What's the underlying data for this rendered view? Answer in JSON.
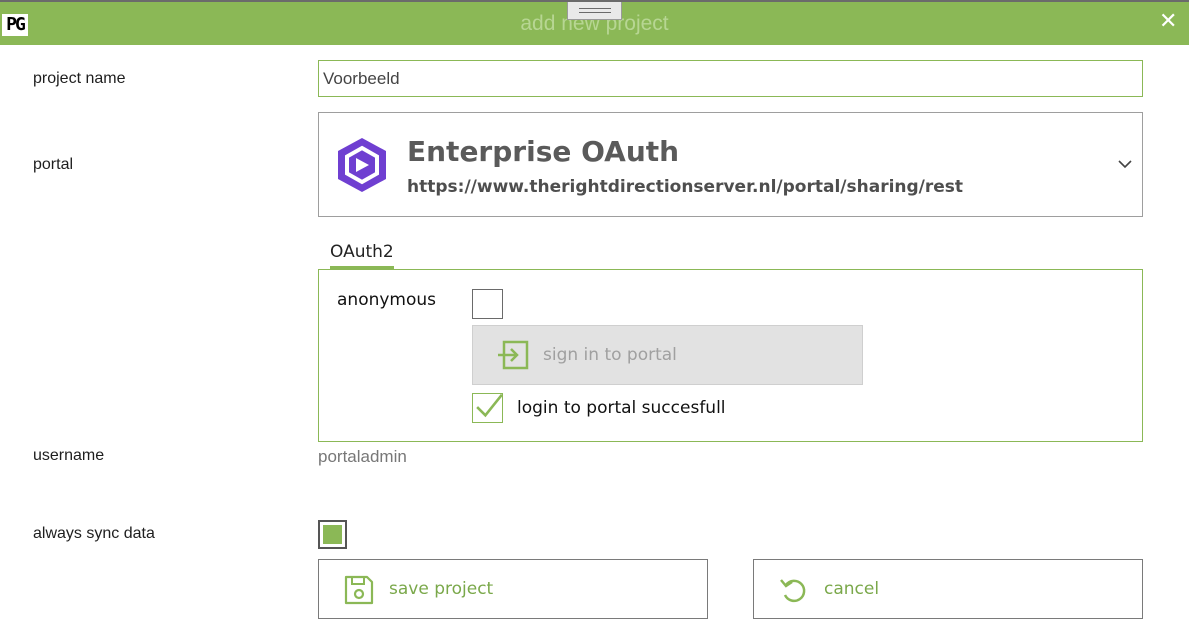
{
  "window": {
    "title": "add new project",
    "logo_text": "PG",
    "close_glyph": "✕"
  },
  "form": {
    "project_name_label": "project name",
    "project_name_value": "Voorbeeld",
    "portal_label": "portal",
    "portal": {
      "name": "Enterprise OAuth",
      "url": "https://www.therightdirectionserver.nl/portal/sharing/rest"
    },
    "tab_label": "OAuth2",
    "auth": {
      "anonymous_label": "anonymous",
      "anonymous_checked": false,
      "sign_in_label": "sign in to portal",
      "success_label": "login to portal succesfull",
      "success_checked": true
    },
    "username_label": "username",
    "username_value": "portaladmin",
    "sync_label": "always sync data",
    "sync_checked": true
  },
  "actions": {
    "save_label": "save project",
    "cancel_label": "cancel"
  },
  "colors": {
    "accent": "#8bb856",
    "portal_logo": "#6f3fd1"
  },
  "icons": {
    "close": "close-icon",
    "portal_logo": "enterprise-logo-icon",
    "dropdown": "chevron-down-icon",
    "sign_in": "sign-in-icon",
    "checkmark": "checkmark-icon",
    "save": "save-icon",
    "cancel": "undo-icon"
  }
}
